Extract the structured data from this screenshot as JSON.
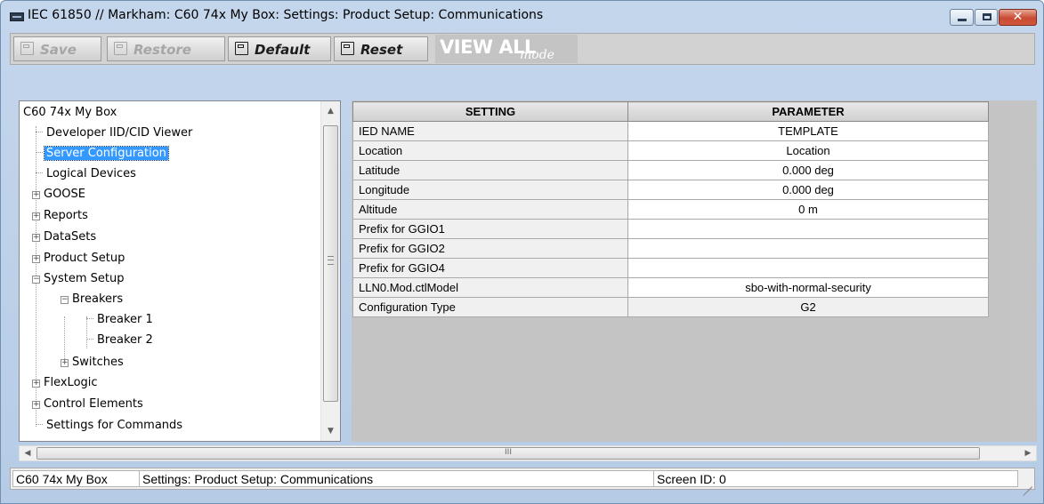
{
  "window": {
    "title": "IEC 61850 // Markham: C60 74x My Box: Settings: Product Setup: Communications",
    "controls": {
      "minimize_icon": "minimize-icon",
      "maximize_icon": "maximize-icon",
      "close_icon": "close-icon",
      "close_glyph": "✕"
    }
  },
  "toolbar": {
    "save_label": "Save",
    "restore_label": "Restore",
    "default_label": "Default",
    "reset_label": "Reset",
    "view_all_label": "VIEW ALL",
    "view_all_mode": "mode"
  },
  "tree": {
    "items": [
      {
        "label": "C60 74x My Box"
      },
      {
        "label": "Developer IID/CID Viewer"
      },
      {
        "label": "Server Configuration",
        "selected": true
      },
      {
        "label": "Logical Devices"
      },
      {
        "label": "GOOSE",
        "expander": "+"
      },
      {
        "label": "Reports",
        "expander": "+"
      },
      {
        "label": "DataSets",
        "expander": "+"
      },
      {
        "label": "Product Setup",
        "expander": "+"
      },
      {
        "label": "System Setup",
        "expander": "−"
      },
      {
        "label": "Breakers",
        "expander": "−"
      },
      {
        "label": "Breaker 1"
      },
      {
        "label": "Breaker 2"
      },
      {
        "label": "Switches",
        "expander": "+"
      },
      {
        "label": "FlexLogic",
        "expander": "+"
      },
      {
        "label": "Control Elements",
        "expander": "+"
      },
      {
        "label": "Settings for Commands"
      }
    ],
    "scroll_up": "▲",
    "scroll_down": "▼"
  },
  "table": {
    "headers": {
      "setting": "SETTING",
      "parameter": "PARAMETER"
    },
    "rows": [
      {
        "setting": "IED NAME",
        "parameter": "TEMPLATE"
      },
      {
        "setting": "Location",
        "parameter": "Location"
      },
      {
        "setting": "Latitude",
        "parameter": "0.000 deg"
      },
      {
        "setting": "Longitude",
        "parameter": "0.000 deg"
      },
      {
        "setting": "Altitude",
        "parameter": "0 m"
      },
      {
        "setting": "Prefix for GGIO1",
        "parameter": ""
      },
      {
        "setting": "Prefix for GGIO2",
        "parameter": ""
      },
      {
        "setting": "Prefix for GGIO4",
        "parameter": ""
      },
      {
        "setting": "LLN0.Mod.ctlModel",
        "parameter": "sbo-with-normal-security"
      },
      {
        "setting": "Configuration Type",
        "parameter": "G2"
      }
    ]
  },
  "hscroll": {
    "left": "◀",
    "right": "▶",
    "grip": "III"
  },
  "status": {
    "device": "C60 74x My Box",
    "path": "Settings: Product Setup: Communications",
    "screen_id": "Screen ID: 0"
  }
}
